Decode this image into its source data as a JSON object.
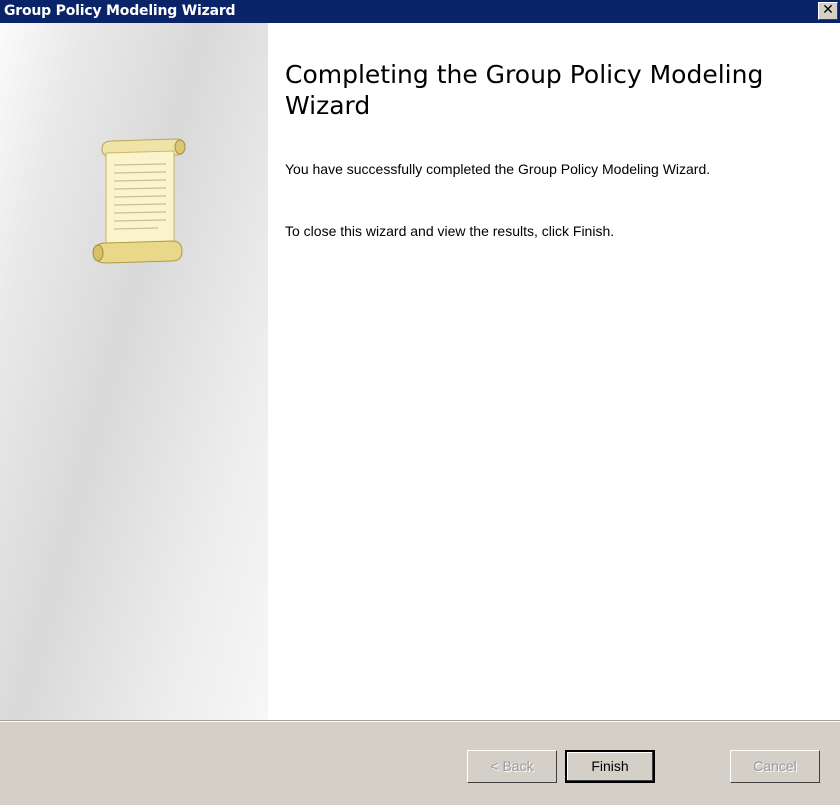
{
  "window": {
    "title": "Group Policy Modeling Wizard",
    "close_label": "✕"
  },
  "sidepanel": {
    "icon": "scroll-icon"
  },
  "content": {
    "heading": "Completing the Group Policy Modeling Wizard",
    "paragraph1": "You have successfully completed the Group Policy Modeling Wizard.",
    "paragraph2": "To close this wizard and view the results, click Finish."
  },
  "buttons": {
    "back": {
      "label": "< Back",
      "enabled": false
    },
    "finish": {
      "label": "Finish",
      "enabled": true,
      "default": true
    },
    "cancel": {
      "label": "Cancel",
      "enabled": false
    }
  },
  "colors": {
    "titlebar": "#0a246a",
    "button_face": "#d4d0c8"
  }
}
